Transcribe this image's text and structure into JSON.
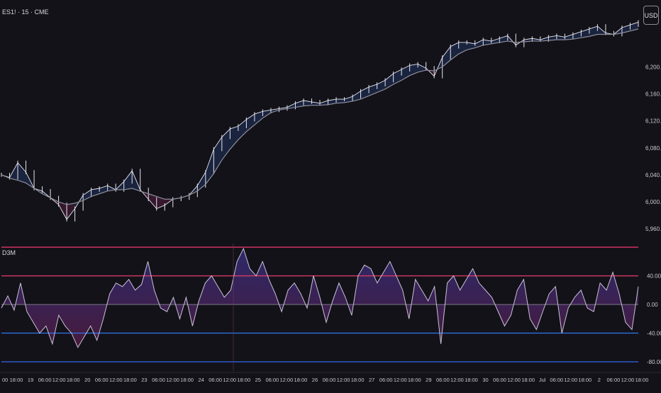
{
  "symbol_label": "ES1! · 15 · CME",
  "oscillator_label": "D3M",
  "currency_button": "USD",
  "colors": {
    "background": "#131219",
    "price": "#e6e6ee",
    "ma": "#8e8e9a",
    "fill_above": "#1c2744",
    "fill_below": "#3a1a30",
    "osc_line": "#c9c3d8",
    "osc_fill_top": "#2e2a6e",
    "osc_fill_bottom": "#4a1b3e",
    "level_outer_top": "#e0356a",
    "level_inner_top": "#d93a62",
    "level_inner_bottom": "#2f6fe0",
    "level_outer_bottom": "#2f5fd8",
    "zero_line": "#9a9aa6",
    "axis_text": "#c8c8d0"
  },
  "chart_data": [
    {
      "type": "line",
      "title": "ES1! · 15 · CME",
      "price_ticks": [
        "6,200.00",
        "6,160.00",
        "6,120.00",
        "6,080.00",
        "6,040.00",
        "6,000.00",
        "5,960.00"
      ],
      "ylim": [
        5955,
        6280
      ],
      "x_tick_labels": [
        "00",
        "18:00",
        "19",
        "06:00",
        "12:00",
        "18:00",
        "20",
        "06:00",
        "12:00",
        "18:00",
        "23",
        "06:00",
        "12:00",
        "18:00",
        "24",
        "06:00",
        "12:00",
        "18:00",
        "25",
        "06:00",
        "12:00",
        "18:00",
        "26",
        "06:00",
        "12:00",
        "18:00",
        "27",
        "06:00",
        "12:00",
        "18:00",
        "29",
        "06:00",
        "12:00",
        "18:00",
        "30",
        "06:00",
        "12:00",
        "18:00",
        "Jul",
        "06:00",
        "12:00",
        "18:00",
        "2",
        "06:00",
        "12:00",
        "18:00"
      ],
      "series": [
        {
          "values": [
            6040,
            6036,
            6058,
            6044,
            6020,
            6016,
            6006,
            5996,
            5974,
            5990,
            6010,
            6018,
            6020,
            6024,
            6018,
            6030,
            6046,
            6018,
            6004,
            5990,
            5995,
            6004,
            6006,
            6010,
            6024,
            6044,
            6078,
            6096,
            6108,
            6112,
            6122,
            6130,
            6134,
            6136,
            6138,
            6140,
            6146,
            6150,
            6148,
            6146,
            6150,
            6152,
            6152,
            6156,
            6164,
            6170,
            6174,
            6180,
            6190,
            6196,
            6202,
            6204,
            6198,
            6186,
            6214,
            6230,
            6236,
            6236,
            6234,
            6240,
            6238,
            6242,
            6246,
            6232,
            6240,
            6242,
            6240,
            6244,
            6246,
            6244,
            6248,
            6252,
            6256,
            6260,
            6250,
            6248,
            6258,
            6262,
            6266
          ]
        },
        {
          "values": [
            6040,
            6035,
            6032,
            6028,
            6020,
            6012,
            6006,
            6000,
            5996,
            5998,
            6002,
            6008,
            6012,
            6016,
            6018,
            6018,
            6020,
            6016,
            6012,
            6008,
            6004,
            6004,
            6006,
            6010,
            6016,
            6026,
            6042,
            6062,
            6078,
            6092,
            6104,
            6114,
            6124,
            6132,
            6136,
            6138,
            6140,
            6142,
            6143,
            6143,
            6144,
            6146,
            6147,
            6149,
            6152,
            6157,
            6162,
            6167,
            6174,
            6180,
            6187,
            6192,
            6195,
            6194,
            6200,
            6210,
            6219,
            6225,
            6228,
            6232,
            6234,
            6236,
            6238,
            6236,
            6237,
            6238,
            6238,
            6239,
            6240,
            6240,
            6241,
            6243,
            6245,
            6248,
            6248,
            6248,
            6250,
            6253,
            6256
          ]
        }
      ]
    },
    {
      "type": "area",
      "title": "D3M",
      "osc_ticks": [
        "40.00",
        "0.00",
        "-40.00",
        "-80.00"
      ],
      "ylim": [
        -85,
        85
      ],
      "levels": [
        80,
        40,
        0,
        -40,
        -80
      ],
      "series": [
        {
          "values": [
            -5,
            12,
            -8,
            30,
            -10,
            -25,
            -40,
            -30,
            -55,
            -15,
            -30,
            -40,
            -60,
            -45,
            -30,
            -50,
            -20,
            15,
            30,
            25,
            35,
            20,
            28,
            60,
            20,
            -5,
            -10,
            10,
            -20,
            10,
            -30,
            5,
            30,
            40,
            25,
            10,
            20,
            60,
            78,
            50,
            40,
            60,
            35,
            15,
            -10,
            20,
            30,
            15,
            -5,
            40,
            10,
            -25,
            5,
            30,
            10,
            -15,
            40,
            55,
            50,
            30,
            45,
            60,
            40,
            20,
            -20,
            35,
            20,
            5,
            25,
            -55,
            30,
            40,
            20,
            35,
            50,
            30,
            20,
            10,
            -10,
            -30,
            -15,
            20,
            35,
            -20,
            -35,
            -10,
            15,
            25,
            -40,
            -5,
            10,
            20,
            -5,
            -10,
            30,
            20,
            45,
            15,
            -25,
            -35,
            25
          ]
        }
      ]
    }
  ]
}
